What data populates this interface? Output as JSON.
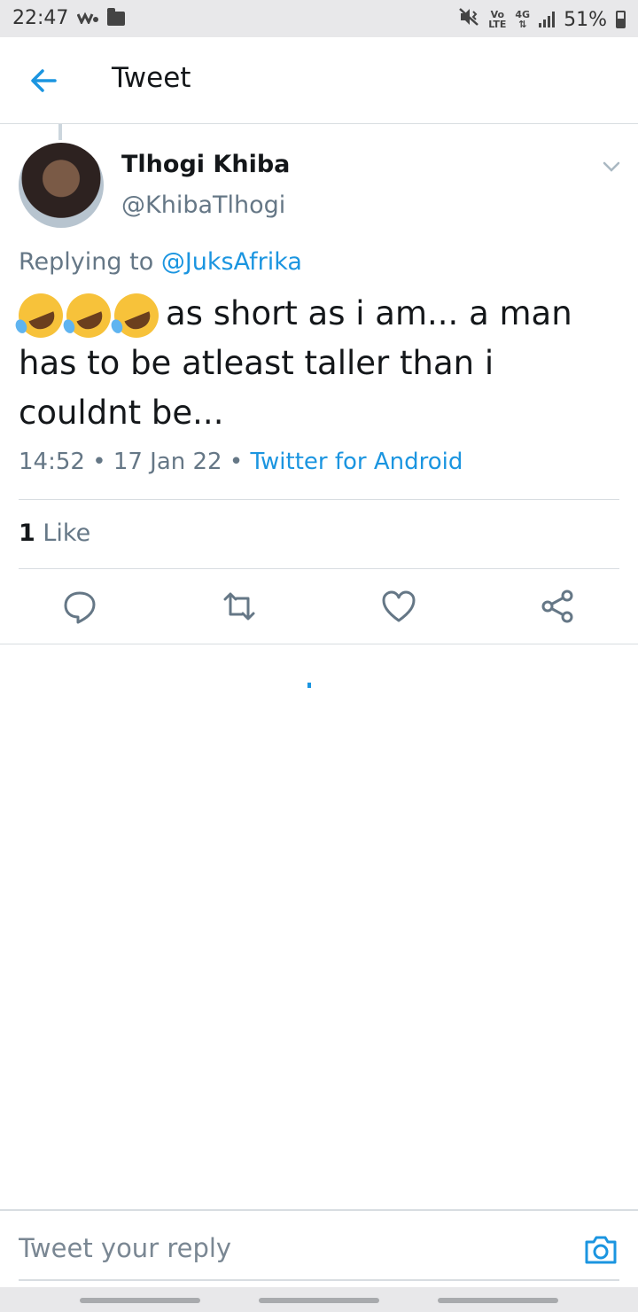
{
  "status_bar": {
    "time": "22:47",
    "battery": "51%",
    "network_top": "Vo",
    "network_bottom": "LTE",
    "signal_type": "4G"
  },
  "header": {
    "title": "Tweet"
  },
  "tweet": {
    "author_name": "Tlhogi Khiba",
    "author_handle": "@KhibaTlhogi",
    "replying_prefix": "Replying to",
    "replying_to": "@JuksAfrika",
    "text": "as short as i am... a man has to be atleast taller than i couldnt be...",
    "emoji_count": 3,
    "time": "14:52",
    "date": "17 Jan 22",
    "separator": "•",
    "source": "Twitter for Android",
    "like_count": "1",
    "like_label": "Like"
  },
  "composer": {
    "placeholder": "Tweet your reply"
  },
  "colors": {
    "accent": "#1b95e0",
    "secondary_text": "#657786",
    "divider": "#d8dde1"
  }
}
